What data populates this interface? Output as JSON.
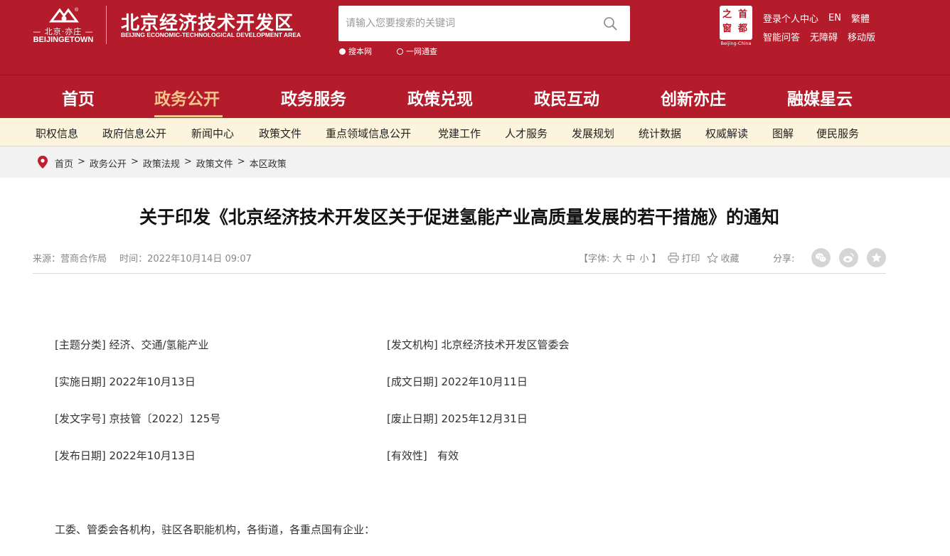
{
  "header": {
    "logo": {
      "sub": "— 北京·亦庄 —",
      "en": "BEIJINGETOWN",
      "icon": "etown-logo"
    },
    "site_title": "北京经济技术开发区",
    "site_subtitle": "BEIJING ECONOMIC-TECHNOLOGICAL DEVELOPMENT AREA",
    "search": {
      "placeholder": "请输入您要搜索的关键词",
      "icon": "search-icon"
    },
    "scopes": [
      {
        "label": "搜本网",
        "selected": true
      },
      {
        "label": "一网通查",
        "selected": false
      }
    ],
    "capital_logo": {
      "chars": [
        "之",
        "首",
        "窗",
        "都"
      ],
      "en": "Beijing-China"
    },
    "toplinks": {
      "row1": [
        "登录个人中心",
        "EN",
        "繁體"
      ],
      "row2": [
        "智能问答",
        "无障碍",
        "移动版"
      ]
    }
  },
  "nav": {
    "items": [
      "首页",
      "政务公开",
      "政务服务",
      "政策兑现",
      "政民互动",
      "创新亦庄",
      "融媒星云"
    ],
    "active": "政务公开"
  },
  "subnav": {
    "items": [
      "职权信息",
      "政府信息公开",
      "新闻中心",
      "政策文件",
      "重点领域信息公开",
      "党建工作",
      "人才服务",
      "发展规划",
      "统计数据",
      "权威解读",
      "图解",
      "便民服务"
    ]
  },
  "breadcrumb": {
    "icon": "location-pin-icon",
    "items": [
      "首页",
      "政务公开",
      "政策法规",
      "政策文件",
      "本区政策"
    ],
    "separator": ">"
  },
  "article": {
    "title": "关于印发《北京经济技术开发区关于促进氢能产业高质量发展的若干措施》的通知",
    "source": "来源：营商合作局",
    "time": "时间：2022年10月14日 09:07",
    "font_label_open": "【字体:",
    "font_sizes": [
      "大",
      "中",
      "小"
    ],
    "font_label_close": "】",
    "print_label": "打印",
    "collect_label": "收藏",
    "share_label": "分享:",
    "share_icons": [
      "wechat-icon",
      "weibo-icon",
      "star-icon"
    ],
    "info": {
      "subject": "[主题分类] 经济、交通/氢能产业",
      "issuer": "[发文机构] 北京经济技术开发区管委会",
      "effective_date": "[实施日期] 2022年10月13日",
      "written_date": "[成文日期] 2022年10月11日",
      "doc_number": "[发文字号] 京技管〔2022〕125号",
      "expiry_date": "[废止日期] 2025年12月31日",
      "publish_date": "[发布日期] 2022年10月13日",
      "validity": "[有效性]   有效"
    },
    "greeting": "工委、管委会各机构，驻区各职能机构，各街道，各重点国有企业："
  },
  "colors": {
    "brand_red": "#b51c2b",
    "nav_active": "#f3c48b",
    "subnav_bg": "#fdf4dd",
    "crumb_bg": "#f2f2f2"
  }
}
